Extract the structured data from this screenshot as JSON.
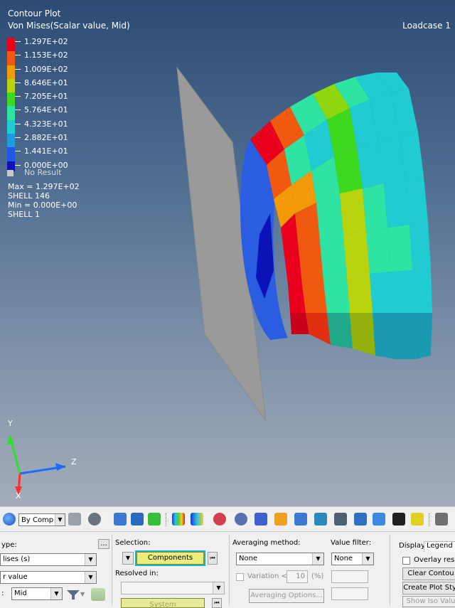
{
  "viewport": {
    "title_line1": "Contour Plot",
    "title_line2": "Von Mises(Scalar value, Mid)",
    "loadcase": "Loadcase 1",
    "legend": [
      {
        "label": "1.297E+02",
        "color": "#e8001c"
      },
      {
        "label": "1.153E+02",
        "color": "#ef5a10"
      },
      {
        "label": "1.009E+02",
        "color": "#f39a08"
      },
      {
        "label": "8.646E+01",
        "color": "#b9d40e"
      },
      {
        "label": "7.205E+01",
        "color": "#3ed91e"
      },
      {
        "label": "5.764E+01",
        "color": "#2fe3a2"
      },
      {
        "label": "4.323E+01",
        "color": "#21cbd2"
      },
      {
        "label": "2.882E+01",
        "color": "#219be0"
      },
      {
        "label": "1.441E+01",
        "color": "#1b58e6"
      },
      {
        "label": "0.000E+00",
        "color": "#0a12b8"
      }
    ],
    "no_result": "No Result",
    "max_line": "Max = 1.297E+02",
    "max_elem": "SHELL 146",
    "min_line": "Min = 0.000E+00",
    "min_elem": "SHELL 1",
    "axis_y": "Y",
    "axis_z": "Z",
    "axis_x": "X"
  },
  "toolbar": {
    "by_comp": "By Comp"
  },
  "panel": {
    "result_type_label": "ype:",
    "result_type_value": "lises (s)",
    "component_value": "r value",
    "layer_label": ":",
    "layer_value": "Mid",
    "selection_label": "Selection:",
    "components_button": "Components",
    "resolved_label": "Resolved in:",
    "resolved_value": "",
    "system_button": "System",
    "averaging_label": "Averaging method:",
    "averaging_value": "None",
    "variation_label": "Variation <",
    "variation_value": "10",
    "variation_unit": "(%)",
    "averaging_options": "Averaging Options...",
    "value_filter_label": "Value filter:",
    "value_filter_value": "None",
    "tab_display": "Display",
    "tab_legend": "Legend",
    "overlay_label": "Overlay resul",
    "clear_contour": "Clear Contou",
    "create_plot_style": "Create Plot Styl",
    "show_iso": "Show Iso Valu",
    "more_button": "..."
  }
}
